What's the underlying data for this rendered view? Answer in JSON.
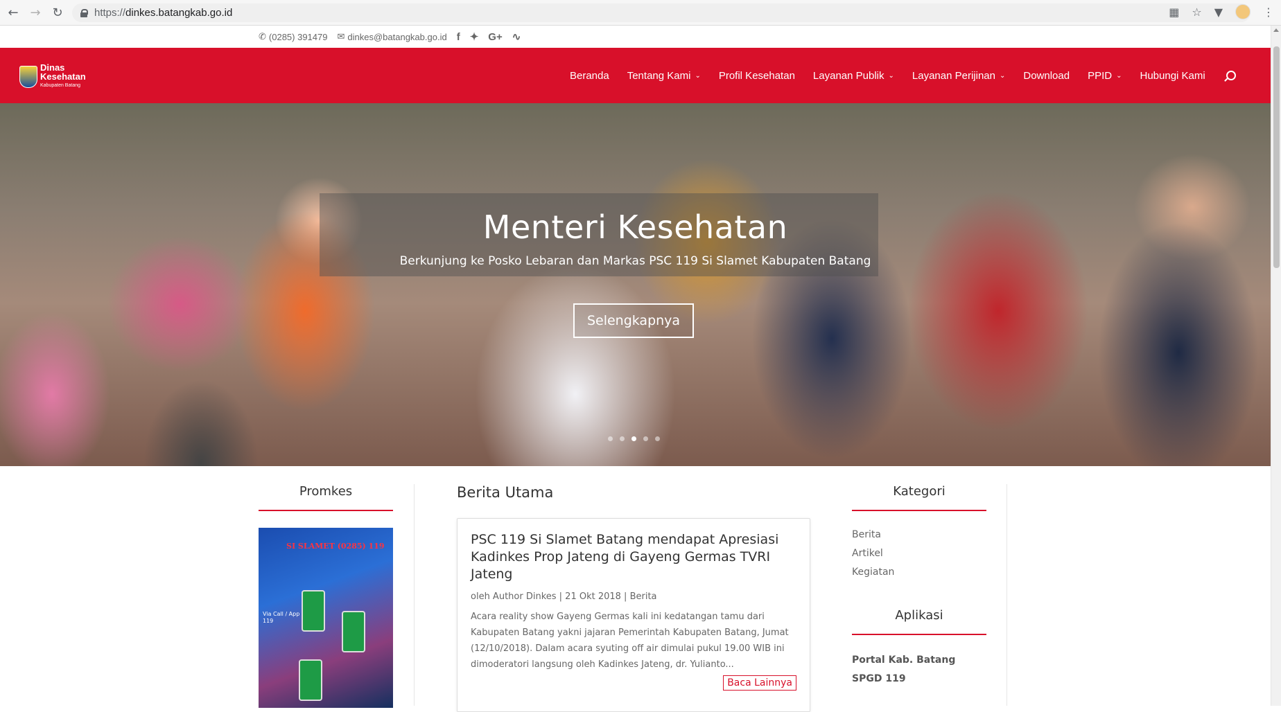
{
  "browser": {
    "url_scheme": "https://",
    "url_host": "dinkes.batangkab.go.id"
  },
  "topbar": {
    "phone": "(0285) 391479",
    "email": "dinkes@batangkab.go.id",
    "social": [
      "f",
      "t",
      "G+",
      "rss"
    ]
  },
  "logo": {
    "line1": "Dinas",
    "line2": "Kesehatan",
    "line3": "Kabupaten Batang"
  },
  "menu": [
    {
      "label": "Beranda",
      "dropdown": false
    },
    {
      "label": "Tentang Kami",
      "dropdown": true
    },
    {
      "label": "Profil Kesehatan",
      "dropdown": false
    },
    {
      "label": "Layanan Publik",
      "dropdown": true
    },
    {
      "label": "Layanan Perijinan",
      "dropdown": true
    },
    {
      "label": "Download",
      "dropdown": false
    },
    {
      "label": "PPID",
      "dropdown": true
    },
    {
      "label": "Hubungi Kami",
      "dropdown": false
    }
  ],
  "hero": {
    "title": "Menteri Kesehatan",
    "subtitle": "Berkunjung ke Posko Lebaran dan Markas PSC 119 Si Slamet Kabupaten Batang",
    "cta": "Selengkapnya",
    "slides": 5,
    "active_slide": 3
  },
  "promkes": {
    "heading": "Promkes"
  },
  "berita": {
    "heading": "Berita Utama",
    "post": {
      "title": "PSC 119 Si Slamet Batang mendapat Apresiasi Kadinkes Prop Jateng di Gayeng Germas TVRI Jateng",
      "meta": "oleh Author Dinkes | 21 Okt 2018 | Berita",
      "excerpt": "Acara reality show Gayeng Germas kali ini kedatangan tamu dari Kabupaten Batang yakni jajaran Pemerintah Kabupaten Batang, Jumat (12/10/2018). Dalam acara syuting off air dimulai pukul 19.00 WIB ini dimoderatori langsung oleh Kadinkes Jateng, dr. Yulianto...",
      "read_more": "Baca Lainnya"
    }
  },
  "kategori": {
    "heading": "Kategori",
    "items": [
      "Berita",
      "Artikel",
      "Kegiatan"
    ]
  },
  "aplikasi": {
    "heading": "Aplikasi",
    "items": [
      "Portal Kab. Batang",
      "SPGD 119"
    ]
  },
  "colors": {
    "brand_red": "#d8102a"
  }
}
